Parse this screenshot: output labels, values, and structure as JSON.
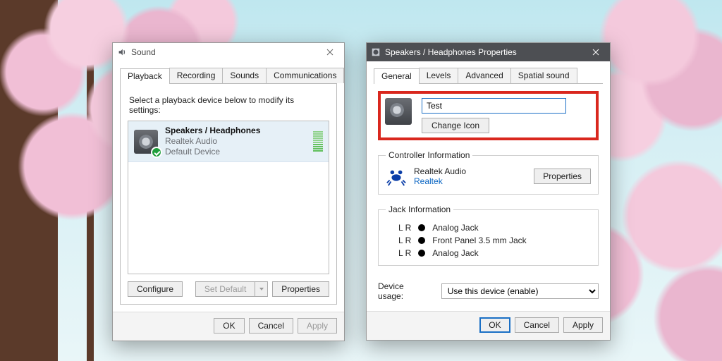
{
  "sound_window": {
    "title": "Sound",
    "tabs": [
      "Playback",
      "Recording",
      "Sounds",
      "Communications"
    ],
    "active_tab": 0,
    "hint": "Select a playback device below to modify its settings:",
    "device": {
      "name": "Speakers / Headphones",
      "driver": "Realtek Audio",
      "status": "Default Device"
    },
    "buttons": {
      "configure": "Configure",
      "set_default": "Set Default",
      "properties": "Properties"
    },
    "footer": {
      "ok": "OK",
      "cancel": "Cancel",
      "apply": "Apply"
    }
  },
  "props_window": {
    "title": "Speakers / Headphones Properties",
    "tabs": [
      "General",
      "Levels",
      "Advanced",
      "Spatial sound"
    ],
    "active_tab": 0,
    "name_value": "Test",
    "change_icon": "Change Icon",
    "controller": {
      "legend": "Controller Information",
      "name": "Realtek Audio",
      "vendor": "Realtek",
      "properties": "Properties"
    },
    "jack": {
      "legend": "Jack Information",
      "rows": [
        {
          "lr": "L R",
          "label": "Analog Jack"
        },
        {
          "lr": "L R",
          "label": "Front Panel 3.5 mm Jack"
        },
        {
          "lr": "L R",
          "label": "Analog Jack"
        }
      ]
    },
    "usage": {
      "label": "Device usage:",
      "selected": "Use this device (enable)"
    },
    "footer": {
      "ok": "OK",
      "cancel": "Cancel",
      "apply": "Apply"
    }
  }
}
